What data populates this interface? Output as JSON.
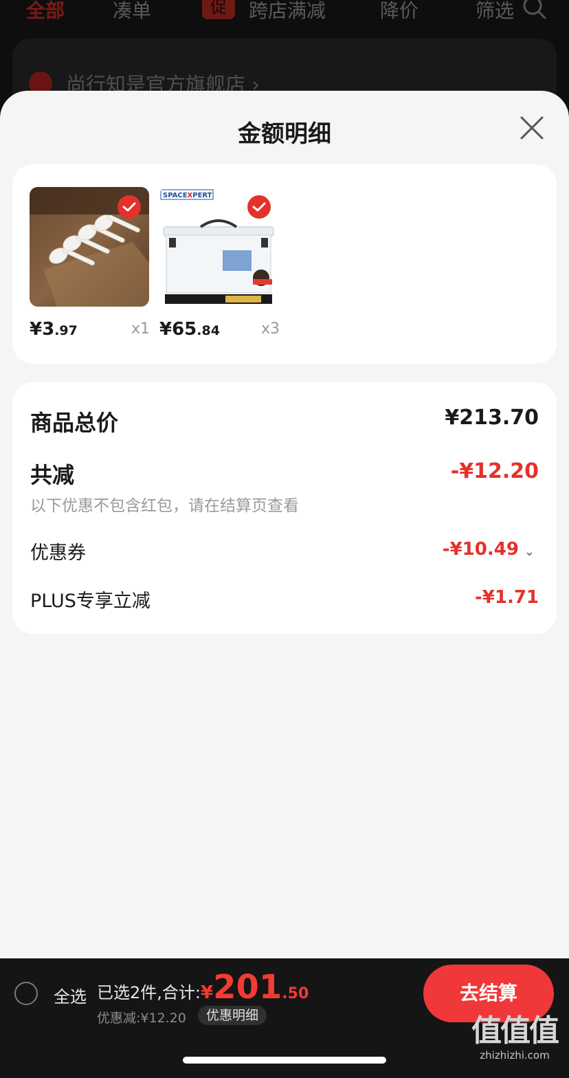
{
  "background": {
    "tabs": [
      "全部",
      "凑单",
      "跨店满减",
      "降价",
      "筛选"
    ],
    "promo_badge": "促",
    "store_name": "尚行知是官方旗舰店 ›"
  },
  "sheet": {
    "title": "金额明细"
  },
  "products": [
    {
      "price_int": "¥3",
      "price_dec": ".97",
      "qty": "x1"
    },
    {
      "price_int": "¥65",
      "price_dec": ".84",
      "qty": "x3",
      "brand_text": "SPACE XPERT"
    }
  ],
  "summary": {
    "total_label": "商品总价",
    "total_value": "¥213.70",
    "reduce_label": "共减",
    "reduce_value": "-¥12.20",
    "reduce_note": "以下优惠不包含红包，请在结算页查看",
    "coupon_label": "优惠券",
    "coupon_value": "-¥10.49",
    "plus_label": "PLUS专享立减",
    "plus_value": "-¥1.71"
  },
  "bottom_bar": {
    "select_all_label": "全选",
    "selected_text": "已选2件,合计:",
    "total_yen": "¥",
    "total_int": "201",
    "total_dec": ".50",
    "discount_text": "优惠减:¥12.20",
    "detail_chip": "优惠明细",
    "checkout_label": "去结算"
  },
  "watermark": {
    "main": "值值值",
    "url": "zhizhizhi.com"
  },
  "colors": {
    "accent_red": "#e4312b",
    "checkout_red": "#f0373a",
    "sheet_bg": "#f5f5f5",
    "bar_bg": "#151515"
  }
}
